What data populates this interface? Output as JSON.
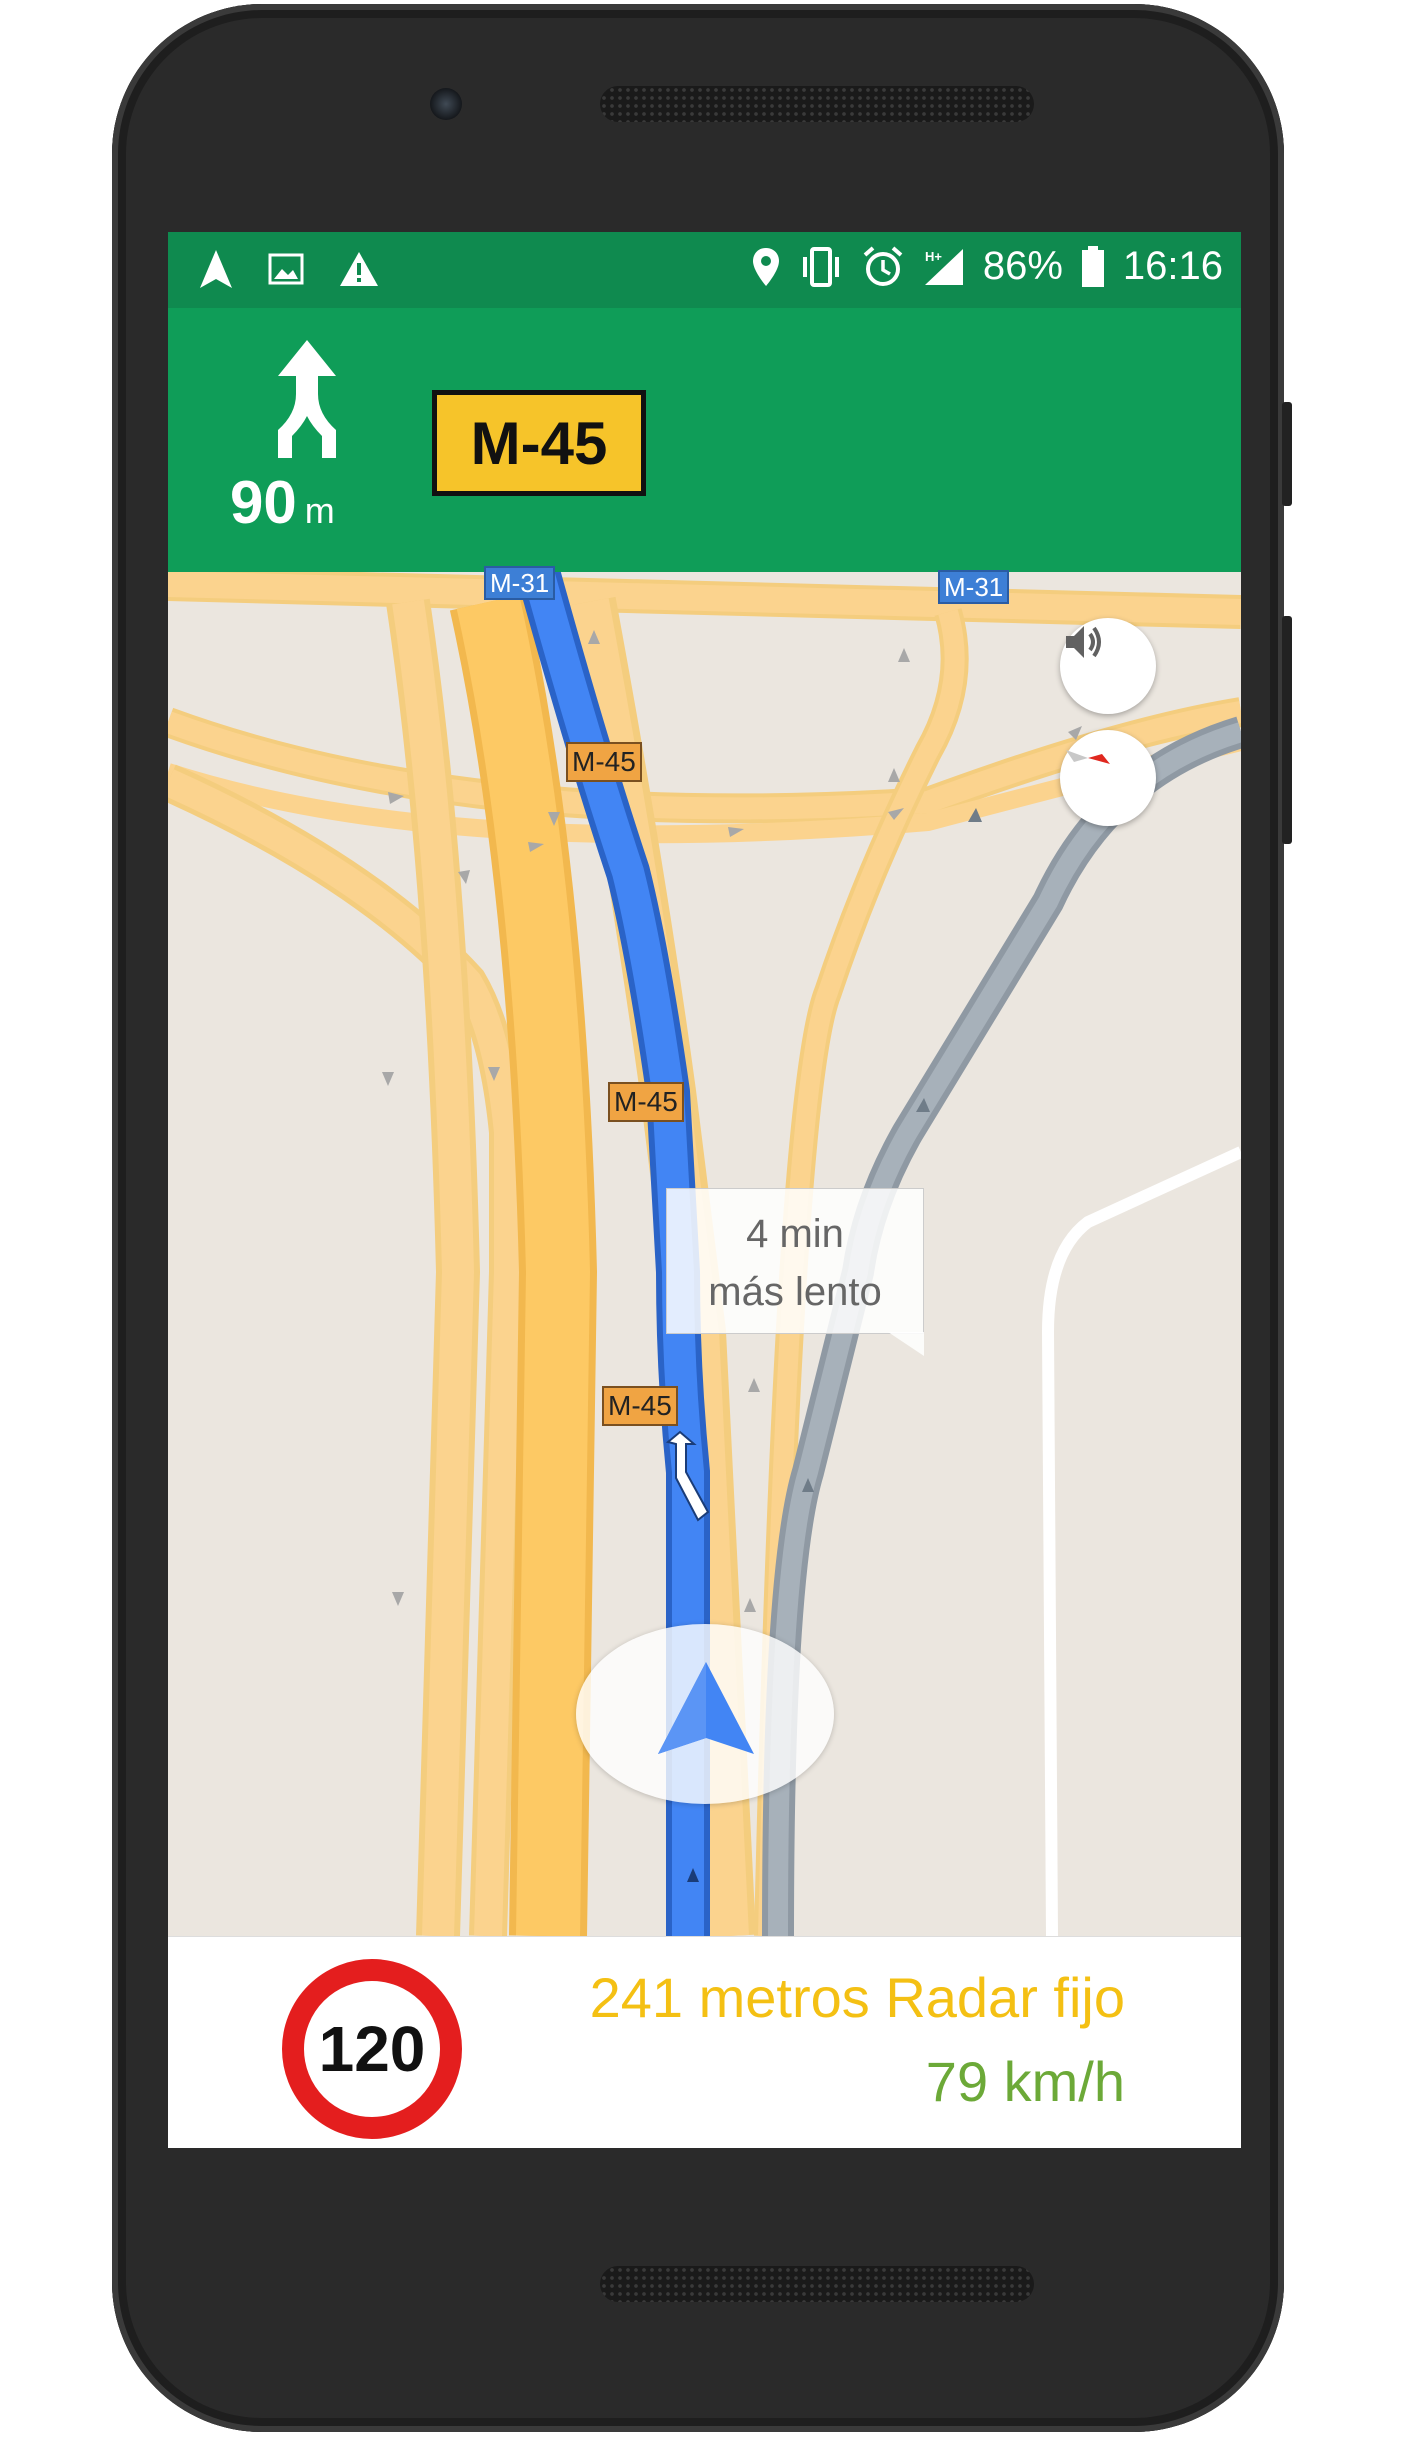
{
  "status_bar": {
    "left_icons": [
      "navigation-icon",
      "image-icon",
      "warning-icon"
    ],
    "right_icons": [
      "location-icon",
      "vibrate-icon",
      "alarm-icon",
      "signal-icon",
      "battery-icon"
    ],
    "network_label": "H+",
    "battery_percent": "86%",
    "time": "16:16"
  },
  "navigation": {
    "maneuver_icon": "merge-icon",
    "distance_value": "90",
    "distance_unit": "m",
    "road_shield": "M-45"
  },
  "map": {
    "road_labels": [
      "M-31",
      "M-31",
      "M-45",
      "M-45",
      "M-45"
    ],
    "callout_line1": "4 min",
    "callout_line2": "más lento",
    "buttons": [
      "volume-icon",
      "compass-icon"
    ]
  },
  "bottom_panel": {
    "speed_limit": "120",
    "warning_text": "241 metros Radar fijo",
    "current_speed": "79 km/h"
  },
  "colors": {
    "header_green": "#0f9d58",
    "status_green": "#0f8a4f",
    "route_blue": "#4285f4",
    "warning_yellow": "#f4c013",
    "speed_green": "#6ca938",
    "speed_sign_red": "#e41e1e"
  }
}
